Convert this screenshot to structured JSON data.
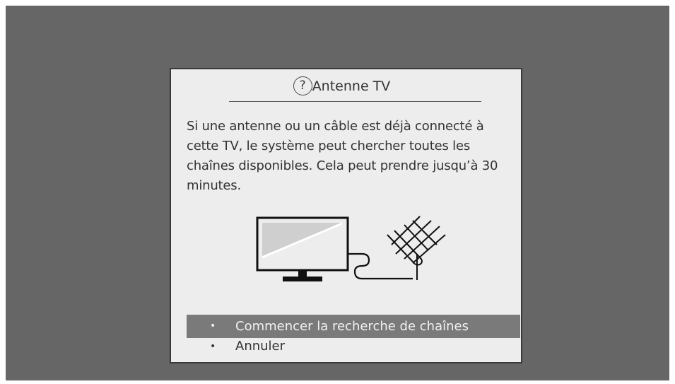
{
  "dialog": {
    "title": "Antenne TV",
    "help_icon": "?",
    "body": "Si une antenne ou un câble est déjà connecté à cette TV, le système peut chercher toutes les chaînes disponibles. Cela peut prendre jusqu’à 30 minutes.",
    "illustration_icon": "tv-antenna-icon",
    "menu": [
      {
        "label": "Commencer la recherche de chaînes",
        "selected": true
      },
      {
        "label": "Annuler",
        "selected": false
      }
    ],
    "bullet": "•"
  },
  "colors": {
    "background": "#666666",
    "dialog": "#ededed",
    "highlight": "#7a7a7a"
  }
}
